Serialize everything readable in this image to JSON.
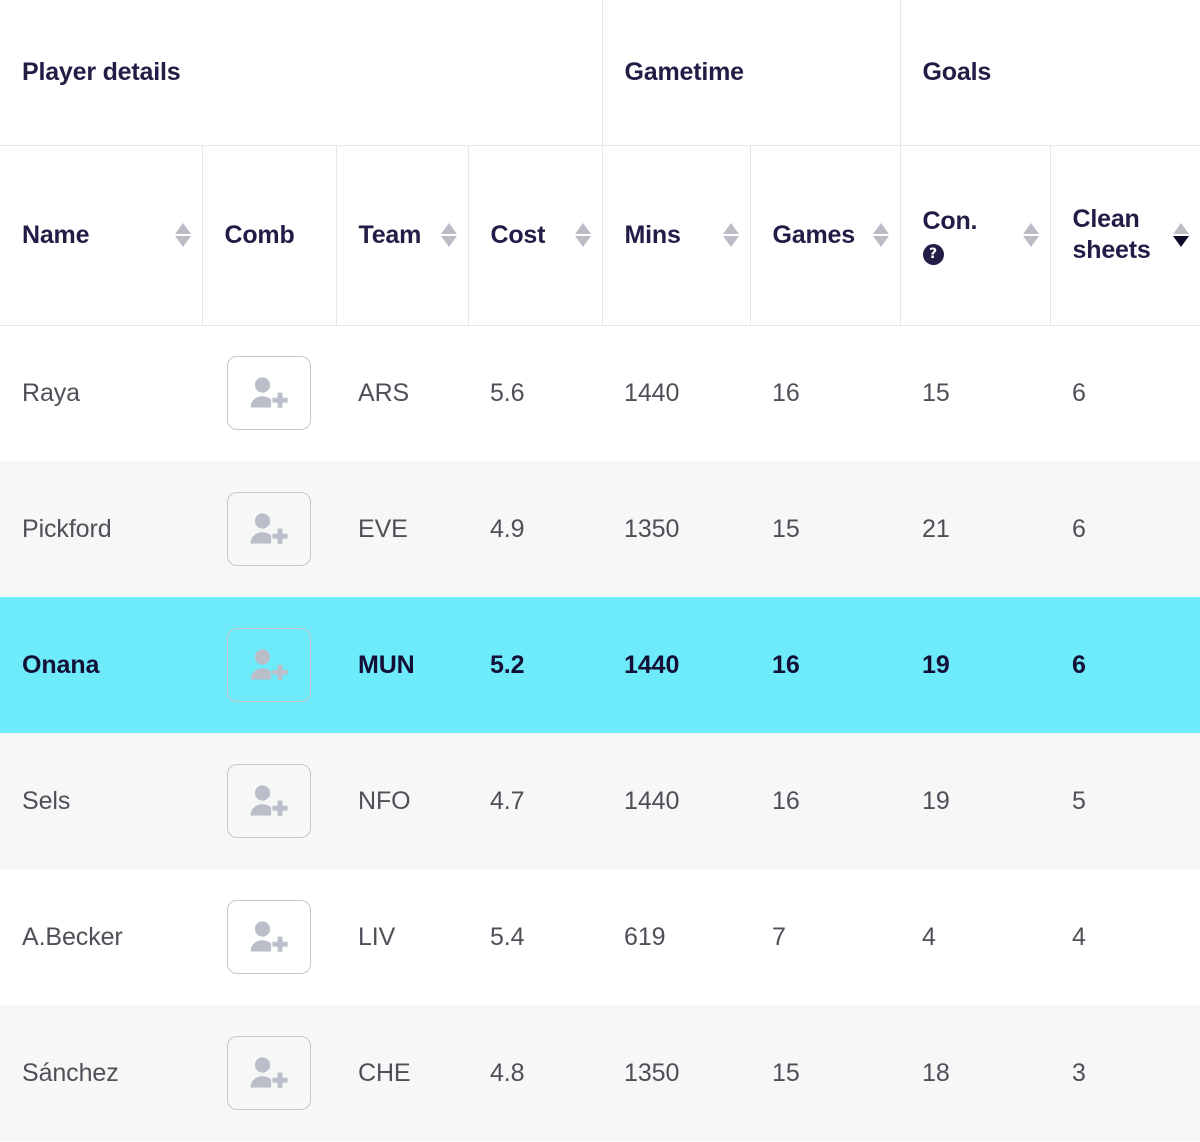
{
  "table": {
    "group_headers": [
      {
        "label": "Player details",
        "span": 4
      },
      {
        "label": "Gametime",
        "span": 2
      },
      {
        "label": "Goals",
        "span": 2
      }
    ],
    "columns": [
      {
        "key": "name",
        "label": "Name",
        "sortable": true,
        "sort": "none"
      },
      {
        "key": "comb",
        "label": "Comb",
        "sortable": false,
        "sort": "none"
      },
      {
        "key": "team",
        "label": "Team",
        "sortable": true,
        "sort": "none"
      },
      {
        "key": "cost",
        "label": "Cost",
        "sortable": true,
        "sort": "none"
      },
      {
        "key": "mins",
        "label": "Mins",
        "sortable": true,
        "sort": "none"
      },
      {
        "key": "games",
        "label": "Games",
        "sortable": true,
        "sort": "none"
      },
      {
        "key": "con",
        "label": "Con.",
        "sortable": true,
        "sort": "none",
        "help_icon": "question-mark-icon",
        "help_label": "?"
      },
      {
        "key": "clean_sheets",
        "label": "Clean sheets",
        "sortable": true,
        "sort": "desc"
      }
    ],
    "add_button_icon": "add-person-icon",
    "rows": [
      {
        "name": "Raya",
        "team": "ARS",
        "cost": "5.6",
        "mins": "1440",
        "games": "16",
        "con": "15",
        "clean_sheets": "6",
        "selected": false
      },
      {
        "name": "Pickford",
        "team": "EVE",
        "cost": "4.9",
        "mins": "1350",
        "games": "15",
        "con": "21",
        "clean_sheets": "6",
        "selected": false
      },
      {
        "name": "Onana",
        "team": "MUN",
        "cost": "5.2",
        "mins": "1440",
        "games": "16",
        "con": "19",
        "clean_sheets": "6",
        "selected": true
      },
      {
        "name": "Sels",
        "team": "NFO",
        "cost": "4.7",
        "mins": "1440",
        "games": "16",
        "con": "19",
        "clean_sheets": "5",
        "selected": false
      },
      {
        "name": "A.Becker",
        "team": "LIV",
        "cost": "5.4",
        "mins": "619",
        "games": "7",
        "con": "4",
        "clean_sheets": "4",
        "selected": false
      },
      {
        "name": "Sánchez",
        "team": "CHE",
        "cost": "4.8",
        "mins": "1350",
        "games": "15",
        "con": "18",
        "clean_sheets": "3",
        "selected": false
      }
    ]
  },
  "colors": {
    "selected_row": "#6debfa",
    "stripe_row": "#f7f7f8",
    "header_text": "#221c46",
    "body_text": "#4f4f57",
    "border": "#e8e8ec",
    "sort_inactive": "#bcbcc6",
    "sort_active": "#0c0a26"
  }
}
